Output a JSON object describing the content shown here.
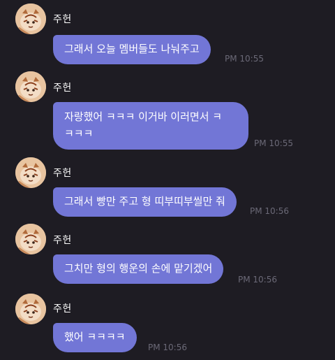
{
  "messages": [
    {
      "sender": "주헌",
      "text": "그래서 오늘 멤버들도 나눠주고",
      "time": "PM 10:55"
    },
    {
      "sender": "주헌",
      "text_line1": "자랑했어 ㅋㅋㅋ 이거바 이러면서 ㅋ",
      "text_line2": "ㅋㅋㅋ",
      "time": "PM 10:55"
    },
    {
      "sender": "주헌",
      "text": "그래서 빵만 주고 형 띠부띠부씰만 줘",
      "time": "PM 10:56"
    },
    {
      "sender": "주헌",
      "text": "그치만 형의 행운의 손에 맡기겠어",
      "time": "PM 10:56"
    },
    {
      "sender": "주헌",
      "text": "했어 ㅋㅋㅋㅋ",
      "time": "PM 10:56"
    }
  ],
  "icons": {
    "avatar": "tiger-avatar-icon"
  },
  "colors": {
    "background": "#1e1c23",
    "bubble": "#7276d6",
    "timestamp": "#6b6977"
  }
}
